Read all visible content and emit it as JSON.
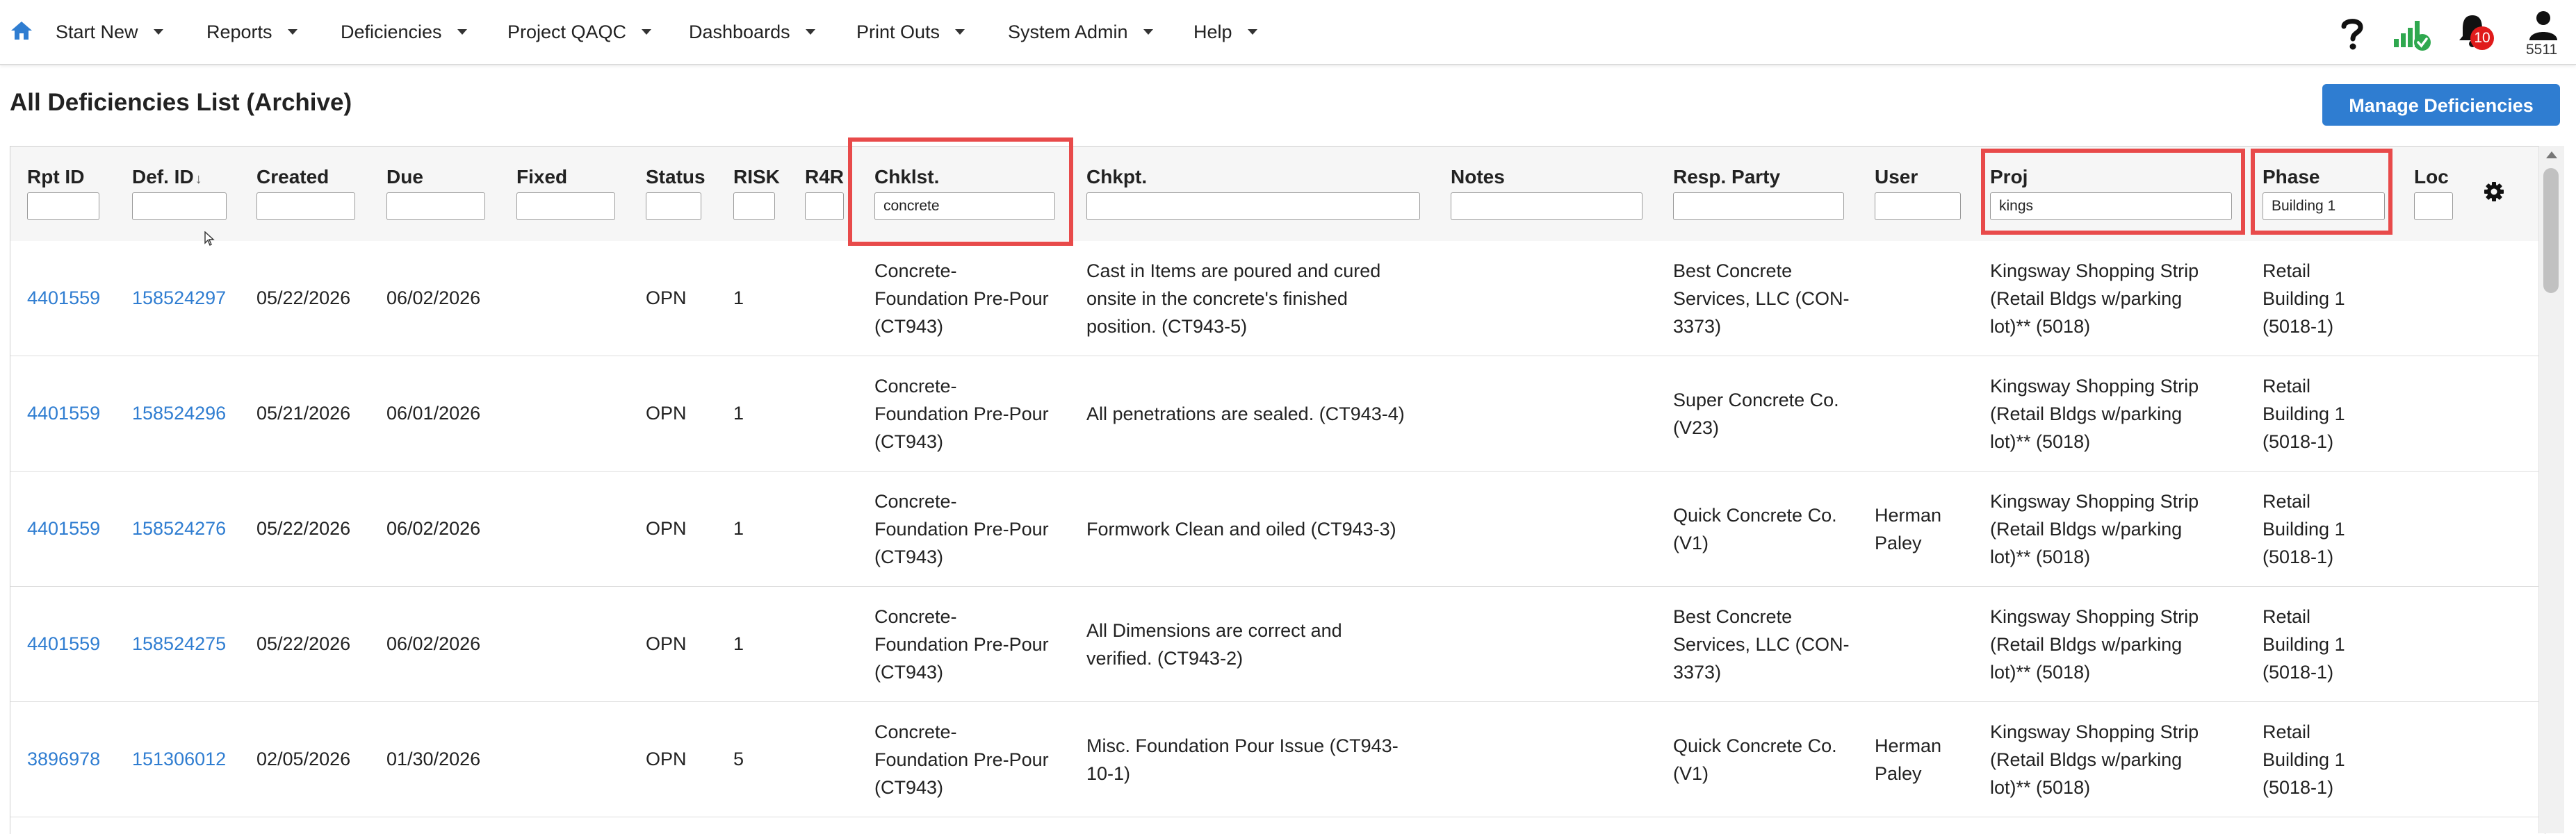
{
  "nav": {
    "items": [
      "Start New",
      "Reports",
      "Deficiencies",
      "Project QAQC",
      "Dashboards",
      "Print Outs",
      "System Admin",
      "Help"
    ],
    "notification_count": "10",
    "user_number": "5511",
    "icons": [
      "home-icon",
      "help-icon",
      "signal-icon",
      "bell-icon",
      "user-icon"
    ]
  },
  "page": {
    "title": "All Deficiencies List (Archive)",
    "manage_button": "Manage Deficiencies"
  },
  "table": {
    "columns": [
      "Rpt ID",
      "Def. ID",
      "Created",
      "Due",
      "Fixed",
      "Status",
      "RISK",
      "R4R",
      "Chklst.",
      "Chkpt.",
      "Notes",
      "Resp. Party",
      "User",
      "Proj",
      "Phase",
      "Loc"
    ],
    "sort_column": "Def. ID",
    "sort_indicator": "↓",
    "filters": {
      "chklst": "concrete",
      "proj": "kings",
      "phase": "Building 1"
    },
    "rows": [
      {
        "rpt_id": "4401559",
        "def_id": "158524297",
        "created": "05/22/2026",
        "due": "06/02/2026",
        "fixed": "",
        "status": "OPN",
        "risk": "1",
        "r4r": "",
        "chklst": [
          "Concrete-",
          "Foundation Pre-Pour",
          "(CT943)"
        ],
        "chkpt": [
          "Cast in Items are poured and cured",
          "onsite in the concrete's finished",
          "position. (CT943-5)"
        ],
        "notes": "",
        "resp": [
          "Best Concrete",
          "Services, LLC (CON-",
          "3373)"
        ],
        "user": [],
        "proj": [
          "Kingsway Shopping Strip",
          "(Retail Bldgs w/parking",
          "lot)** (5018)"
        ],
        "phase": [
          "Retail",
          "Building 1",
          "(5018-1)"
        ],
        "loc": ""
      },
      {
        "rpt_id": "4401559",
        "def_id": "158524296",
        "created": "05/21/2026",
        "due": "06/01/2026",
        "fixed": "",
        "status": "OPN",
        "risk": "1",
        "r4r": "",
        "chklst": [
          "Concrete-",
          "Foundation Pre-Pour",
          "(CT943)"
        ],
        "chkpt": [
          "All penetrations are sealed. (CT943-4)"
        ],
        "notes": "",
        "resp": [
          "Super Concrete Co.",
          "(V23)"
        ],
        "user": [],
        "proj": [
          "Kingsway Shopping Strip",
          "(Retail Bldgs w/parking",
          "lot)** (5018)"
        ],
        "phase": [
          "Retail",
          "Building 1",
          "(5018-1)"
        ],
        "loc": ""
      },
      {
        "rpt_id": "4401559",
        "def_id": "158524276",
        "created": "05/22/2026",
        "due": "06/02/2026",
        "fixed": "",
        "status": "OPN",
        "risk": "1",
        "r4r": "",
        "chklst": [
          "Concrete-",
          "Foundation Pre-Pour",
          "(CT943)"
        ],
        "chkpt": [
          "Formwork Clean and oiled (CT943-3)"
        ],
        "notes": "",
        "resp": [
          "Quick Concrete Co.",
          "(V1)"
        ],
        "user": [
          "Herman",
          "Paley"
        ],
        "proj": [
          "Kingsway Shopping Strip",
          "(Retail Bldgs w/parking",
          "lot)** (5018)"
        ],
        "phase": [
          "Retail",
          "Building 1",
          "(5018-1)"
        ],
        "loc": ""
      },
      {
        "rpt_id": "4401559",
        "def_id": "158524275",
        "created": "05/22/2026",
        "due": "06/02/2026",
        "fixed": "",
        "status": "OPN",
        "risk": "1",
        "r4r": "",
        "chklst": [
          "Concrete-",
          "Foundation Pre-Pour",
          "(CT943)"
        ],
        "chkpt": [
          "All Dimensions are correct and",
          "verified. (CT943-2)"
        ],
        "notes": "",
        "resp": [
          "Best Concrete",
          "Services, LLC (CON-",
          "3373)"
        ],
        "user": [],
        "proj": [
          "Kingsway Shopping Strip",
          "(Retail Bldgs w/parking",
          "lot)** (5018)"
        ],
        "phase": [
          "Retail",
          "Building 1",
          "(5018-1)"
        ],
        "loc": ""
      },
      {
        "rpt_id": "3896978",
        "def_id": "151306012",
        "created": "02/05/2026",
        "due": "01/30/2026",
        "fixed": "",
        "status": "OPN",
        "risk": "5",
        "r4r": "",
        "chklst": [
          "Concrete-",
          "Foundation Pre-Pour",
          "(CT943)"
        ],
        "chkpt": [
          "Misc. Foundation Pour Issue (CT943-",
          "10-1)"
        ],
        "notes": "",
        "resp": [
          "Quick Concrete Co.",
          "(V1)"
        ],
        "user": [
          "Herman",
          "Paley"
        ],
        "proj": [
          "Kingsway Shopping Strip",
          "(Retail Bldgs w/parking",
          "lot)** (5018)"
        ],
        "phase": [
          "Retail",
          "Building 1",
          "(5018-1)"
        ],
        "loc": ""
      }
    ]
  }
}
